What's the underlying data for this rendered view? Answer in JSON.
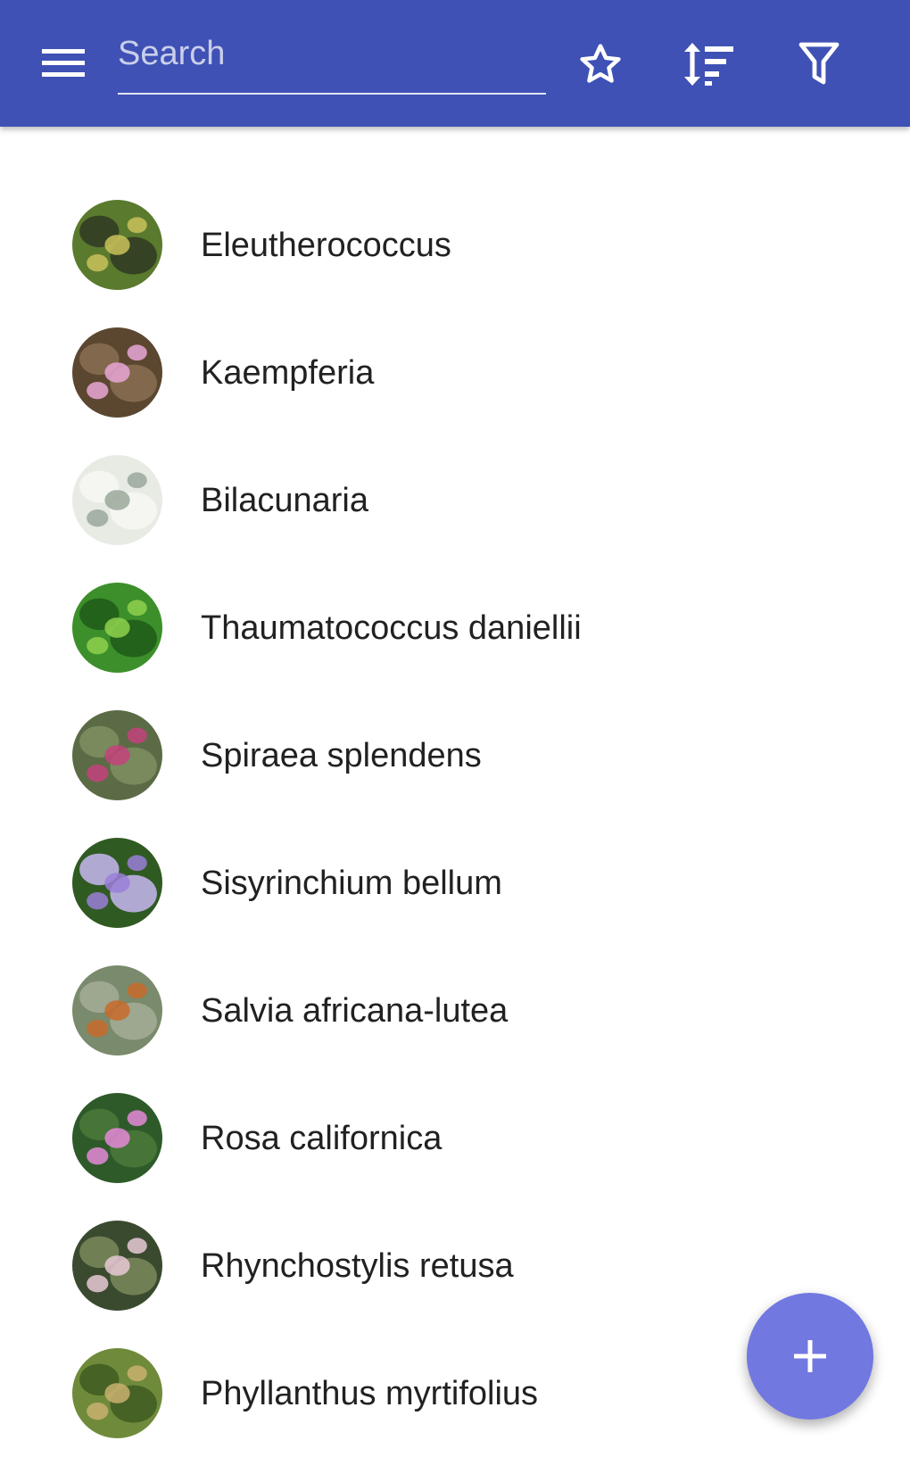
{
  "app_bar": {
    "background": "#3f51b5",
    "menu_icon": "hamburger-menu-icon",
    "search": {
      "placeholder": "Search",
      "value": ""
    },
    "actions": [
      {
        "name": "favorites",
        "icon": "star-outline-icon"
      },
      {
        "name": "sort",
        "icon": "sort-icon"
      },
      {
        "name": "filter",
        "icon": "filter-icon"
      }
    ]
  },
  "plants": [
    {
      "name": "Eleutherococcus",
      "thumbnail": "plant-photo",
      "colors": [
        "#5a7a2e",
        "#c9c25a",
        "#2f3a22"
      ]
    },
    {
      "name": "Kaempferia",
      "thumbnail": "plant-photo",
      "colors": [
        "#5b4630",
        "#e9a7d6",
        "#8a7052"
      ]
    },
    {
      "name": "Bilacunaria",
      "thumbnail": "plant-photo",
      "colors": [
        "#e8ebe4",
        "#9aa89a",
        "#f7f8f5"
      ]
    },
    {
      "name": "Thaumatococcus daniellii",
      "thumbnail": "plant-photo",
      "colors": [
        "#3c8f2a",
        "#8fd14f",
        "#1f5a18"
      ]
    },
    {
      "name": "Spiraea splendens",
      "thumbnail": "plant-photo",
      "colors": [
        "#5b6b45",
        "#c4427c",
        "#7f8f62"
      ]
    },
    {
      "name": "Sisyrinchium bellum",
      "thumbnail": "plant-photo",
      "colors": [
        "#2f5a22",
        "#9a7fd8",
        "#c7b7f0"
      ]
    },
    {
      "name": "Salvia africana-lutea",
      "thumbnail": "plant-photo",
      "colors": [
        "#7a8a6c",
        "#c86a2a",
        "#a5ac95"
      ]
    },
    {
      "name": "Rosa californica",
      "thumbnail": "plant-photo",
      "colors": [
        "#2e5a2a",
        "#e58ad8",
        "#4a7a3a"
      ]
    },
    {
      "name": "Rhynchostylis retusa",
      "thumbnail": "plant-photo",
      "colors": [
        "#3a4a2e",
        "#e9c9d6",
        "#7a8a5a"
      ]
    },
    {
      "name": "Phyllanthus myrtifolius",
      "thumbnail": "plant-photo",
      "colors": [
        "#6f8a3a",
        "#c9b070",
        "#3f5a22"
      ]
    }
  ],
  "fab": {
    "icon": "plus-icon",
    "background": "#7178e0"
  }
}
